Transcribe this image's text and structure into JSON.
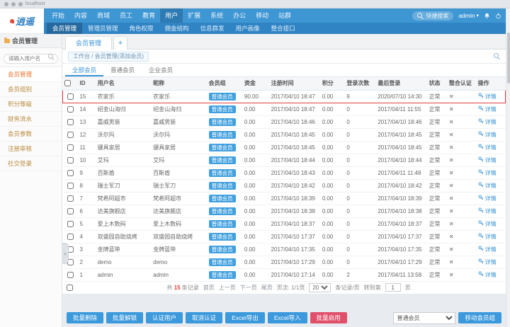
{
  "colors": {
    "primary": "#3b94d6",
    "badge": "#41a0df",
    "danger": "#e0506b",
    "highlight": "#e03b3b"
  },
  "browser": {
    "url": "localhost"
  },
  "topnav": {
    "logo": "逍遥",
    "items": [
      "开始",
      "内容",
      "商城",
      "员工",
      "教育",
      "用户",
      "扩展",
      "系统",
      "办公",
      "移动",
      "站群"
    ],
    "active": "用户",
    "search_placeholder": "快捷搜索",
    "user": "admin",
    "caret": "▾"
  },
  "subnav": {
    "items": [
      "会员管理",
      "管理员管理",
      "角色权限",
      "佣金结构",
      "信息群发",
      "用户画像",
      "整合接口"
    ],
    "active": "会员管理"
  },
  "sidebar": {
    "title": "会员管理",
    "search_placeholder": "请输入用户名",
    "items": [
      "会员管理",
      "会员组别",
      "积分等级",
      "财务流水",
      "会员参数",
      "注册审核",
      "社交登录"
    ],
    "active": "会员管理"
  },
  "main": {
    "tab": "会员管理",
    "add_tab": "+",
    "breadcrumb": "工作台 / 会员管理(添加会员)",
    "filter_tabs": [
      "全部会员",
      "普通会员",
      "企业会员"
    ],
    "filter_active": "全部会员",
    "move_button": "移动会员组",
    "group_select_value": "普通会员",
    "collapse_glyph": "«"
  },
  "table": {
    "headers": [
      "ID",
      "用户名",
      "昵称",
      "会员组",
      "资金",
      "注册时间",
      "积分",
      "登录次数",
      "最后登录",
      "状态",
      "整合认证",
      "操作"
    ],
    "rows": [
      {
        "id": "15",
        "username": "农家乐",
        "nickname": "农家乐",
        "group": "普通会员",
        "money": "90.00",
        "registered": "2017/04/10 18:47",
        "points": "0.00",
        "logins": "9",
        "last_login": "2020/07/10 14:30",
        "status": "正常",
        "auth": "✕",
        "action": "详情",
        "highlight": true
      },
      {
        "id": "14",
        "username": "绍金山海归",
        "nickname": "绍金山海归",
        "group": "普通会员",
        "money": "0.00",
        "registered": "2017/04/10 18:47",
        "points": "0.00",
        "logins": "0",
        "last_login": "2017/04/11 11:55",
        "status": "正常",
        "auth": "✕",
        "action": "详情",
        "highlight": false
      },
      {
        "id": "13",
        "username": "嘉威男装",
        "nickname": "嘉威男装",
        "group": "普通会员",
        "money": "0.00",
        "registered": "2017/04/10 18:46",
        "points": "0.00",
        "logins": "0",
        "last_login": "2017/04/10 18:46",
        "status": "正常",
        "auth": "✕",
        "action": "详情",
        "highlight": false
      },
      {
        "id": "12",
        "username": "沃尔玛",
        "nickname": "沃尔玛",
        "group": "普通会员",
        "money": "0.00",
        "registered": "2017/04/10 18:45",
        "points": "0.00",
        "logins": "0",
        "last_login": "2017/04/10 18:45",
        "status": "正常",
        "auth": "✕",
        "action": "详情",
        "highlight": false
      },
      {
        "id": "11",
        "username": "键具家居",
        "nickname": "键具家居",
        "group": "普通会员",
        "money": "0.00",
        "registered": "2017/04/10 18:45",
        "points": "0.00",
        "logins": "0",
        "last_login": "2017/04/10 18:45",
        "status": "正常",
        "auth": "✕",
        "action": "详情",
        "highlight": false
      },
      {
        "id": "10",
        "username": "艾玛",
        "nickname": "艾玛",
        "group": "普通会员",
        "money": "0.00",
        "registered": "2017/04/10 18:44",
        "points": "0.00",
        "logins": "0",
        "last_login": "2017/04/10 18:44",
        "status": "正常",
        "auth": "✕",
        "action": "详情",
        "highlight": false
      },
      {
        "id": "9",
        "username": "百斯盾",
        "nickname": "百斯盾",
        "group": "普通会员",
        "money": "0.00",
        "registered": "2017/04/10 18:43",
        "points": "0.00",
        "logins": "0",
        "last_login": "2017/04/11 11:48",
        "status": "正常",
        "auth": "✕",
        "action": "详情",
        "highlight": false
      },
      {
        "id": "8",
        "username": "瑞士军刀",
        "nickname": "瑞士军刀",
        "group": "普通会员",
        "money": "0.00",
        "registered": "2017/04/10 18:42",
        "points": "0.00",
        "logins": "0",
        "last_login": "2017/04/10 18:42",
        "status": "正常",
        "auth": "✕",
        "action": "详情",
        "highlight": false
      },
      {
        "id": "7",
        "username": "梵希阿超市",
        "nickname": "梵希阿超市",
        "group": "普通会员",
        "money": "0.00",
        "registered": "2017/04/10 18:39",
        "points": "0.00",
        "logins": "0",
        "last_login": "2017/04/10 18:39",
        "status": "正常",
        "auth": "✕",
        "action": "详情",
        "highlight": false
      },
      {
        "id": "6",
        "username": "达美旗舰店",
        "nickname": "达美旗舰店",
        "group": "普通会员",
        "money": "0.00",
        "registered": "2017/04/10 18:38",
        "points": "0.00",
        "logins": "0",
        "last_login": "2017/04/10 18:38",
        "status": "正常",
        "auth": "✕",
        "action": "详情",
        "highlight": false
      },
      {
        "id": "5",
        "username": "爱上木数码",
        "nickname": "爱上木数码",
        "group": "普通会员",
        "money": "0.00",
        "registered": "2017/04/10 18:37",
        "points": "0.00",
        "logins": "0",
        "last_login": "2017/04/10 18:37",
        "status": "正常",
        "auth": "✕",
        "action": "详情",
        "highlight": false
      },
      {
        "id": "4",
        "username": "双盛园自助烧烤",
        "nickname": "双盛园自助烧烤",
        "group": "普通会员",
        "money": "0.00",
        "registered": "2017/04/10 17:37",
        "points": "0.00",
        "logins": "0",
        "last_login": "2017/04/10 17:37",
        "status": "正常",
        "auth": "✕",
        "action": "详情",
        "highlight": false
      },
      {
        "id": "3",
        "username": "金牌蓝带",
        "nickname": "金牌蓝带",
        "group": "普通会员",
        "money": "0.00",
        "registered": "2017/04/10 17:35",
        "points": "0.00",
        "logins": "0",
        "last_login": "2017/04/10 17:35",
        "status": "正常",
        "auth": "✕",
        "action": "详情",
        "highlight": false
      },
      {
        "id": "2",
        "username": "demo",
        "nickname": "demo",
        "group": "普通会员",
        "money": "0.00",
        "registered": "2017/04/10 17:29",
        "points": "0.00",
        "logins": "0",
        "last_login": "2017/04/10 17:29",
        "status": "正常",
        "auth": "✕",
        "action": "详情",
        "highlight": false
      },
      {
        "id": "1",
        "username": "admin",
        "nickname": "admin",
        "group": "普通会员",
        "money": "0.00",
        "registered": "2017/04/10 17:14",
        "points": "0.00",
        "logins": "2",
        "last_login": "2017/04/11 13:58",
        "status": "正常",
        "auth": "✕",
        "action": "详情",
        "highlight": false
      }
    ]
  },
  "pagination": {
    "total_prefix": "共",
    "total_count": "15",
    "total_suffix": "条记录",
    "links": [
      "首页",
      "上一页",
      "下一页",
      "尾页"
    ],
    "page_label": "页次:",
    "page_value": "1/1页",
    "per_page": "20",
    "per_page_label": "条记录/页",
    "goto_prefix": "转到第",
    "goto_value": "1",
    "goto_suffix": "页"
  },
  "actions": [
    {
      "label": "批量删除",
      "style": "primary"
    },
    {
      "label": "批量解锁",
      "style": "primary"
    },
    {
      "label": "认证用户",
      "style": "primary"
    },
    {
      "label": "取消认证",
      "style": "primary"
    },
    {
      "label": "Excel导出",
      "style": "primary"
    },
    {
      "label": "Excel导入",
      "style": "primary"
    },
    {
      "label": "批量启用",
      "style": "danger"
    }
  ]
}
